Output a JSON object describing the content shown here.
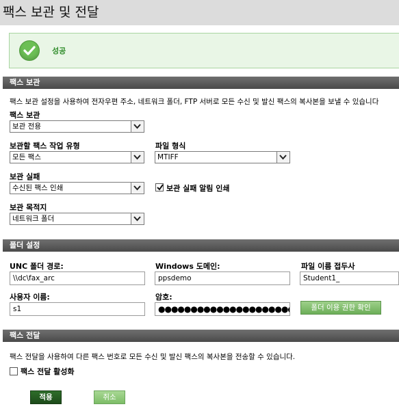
{
  "page": {
    "title": "팩스 보관 및 전달"
  },
  "status": {
    "message": "성공",
    "icon": "checkmark-icon",
    "color": "#6cbf55"
  },
  "archive": {
    "header": "팩스 보관",
    "description": "팩스 보관 설정을 사용하여 전자우편 주소, 네트워크 폴더, FTP 서버로 모든 수신 및 발신 팩스의 복사본을 보낼 수 있습니다",
    "mode_label": "팩스 보관",
    "mode_value": "보관 전용",
    "job_type_label": "보관할 팩스 작업 유형",
    "job_type_value": "모든 팩스",
    "file_format_label": "파일 형식",
    "file_format_value": "MTIFF",
    "failure_label": "보관 실패",
    "failure_value": "수신된 팩스 인쇄",
    "print_notice_label": "보관 실패 알림 인쇄",
    "print_notice_checked": true,
    "destination_label": "보관 목적지",
    "destination_value": "네트워크 폴더"
  },
  "folder": {
    "header": "폴더 설정",
    "unc_label": "UNC 폴더 경로:",
    "unc_value": "\\\\dc\\fax_arc",
    "domain_label": "Windows 도메인:",
    "domain_value": "ppsdemo",
    "prefix_label": "파일 이름 접두사",
    "prefix_value": "Student1_",
    "username_label": "사용자 이름:",
    "username_value": "s1",
    "password_label": "암호:",
    "password_value": "●●●●●●●●●●●●●●●●●●●●●●●●●●●●●●●●●●●●●●●",
    "verify_button": "폴더 이용 권한 확인"
  },
  "forward": {
    "header": "팩스 전달",
    "description": "팩스 전달을 사용하여 다른 팩스 번호로 모든 수신 및 발신 팩스의 복사본을 전송할 수 있습니다.",
    "enable_label": "팩스 전달 활성화",
    "enable_checked": false
  },
  "actions": {
    "apply": "적용",
    "cancel": "취소"
  }
}
